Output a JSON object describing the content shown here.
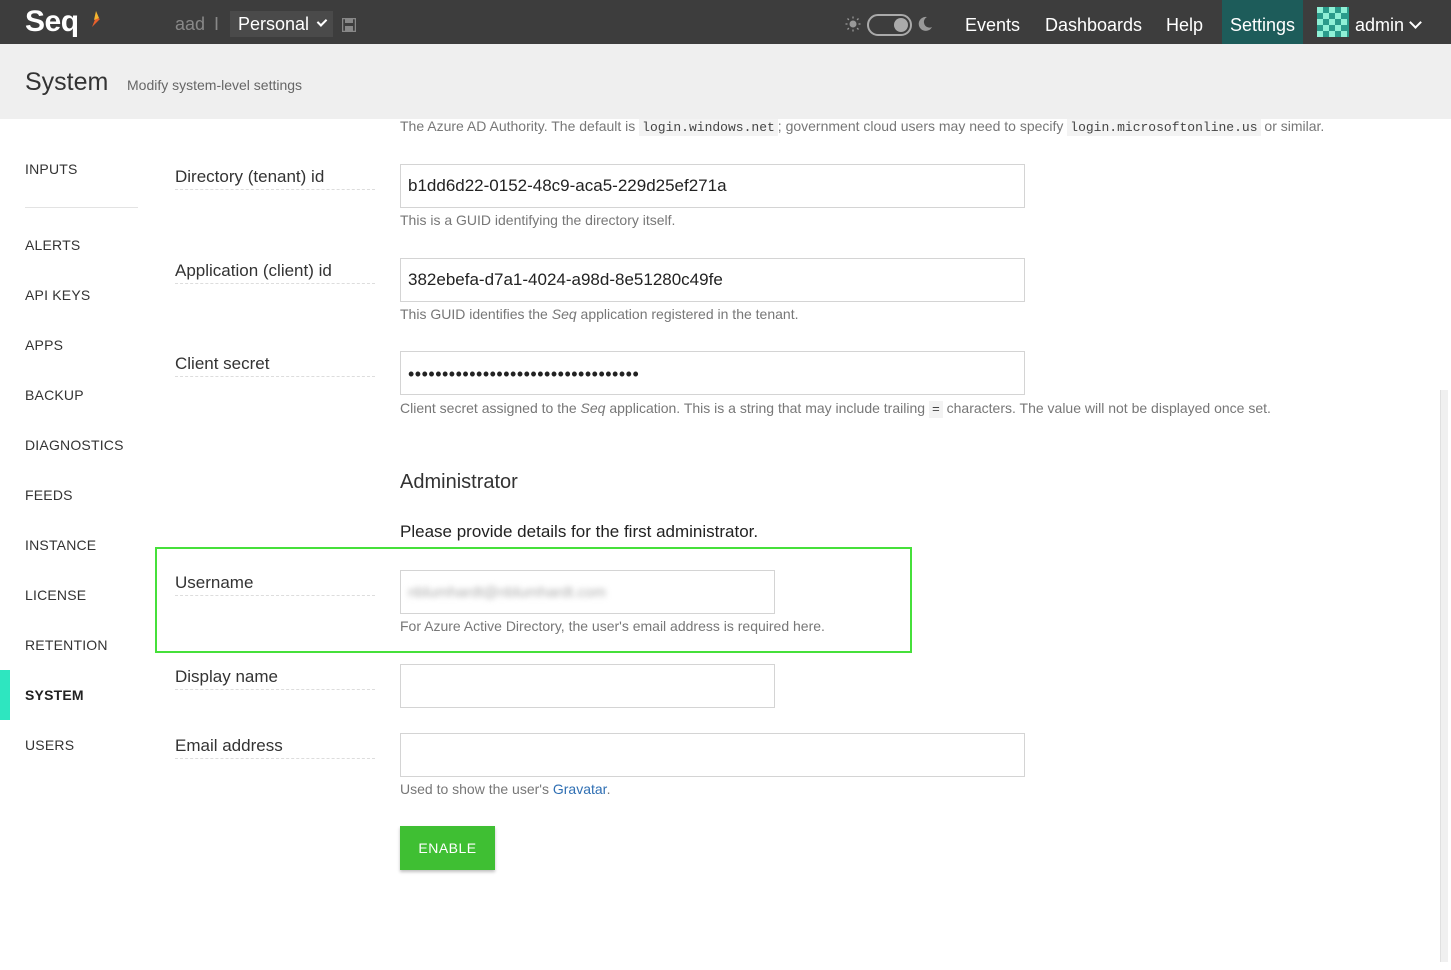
{
  "app": {
    "logo_text": "Seq",
    "workspace_label": "aad",
    "workspace_separator": "I",
    "workspace_select": "Personal",
    "nav": {
      "events": "Events",
      "dashboards": "Dashboards",
      "help": "Help",
      "settings": "Settings"
    },
    "user": "admin",
    "colors": {
      "topbar": "#3d3d3d",
      "settings_active": "#1d5c5a",
      "accent": "#2ee6c0",
      "enable_button": "#3fbf33",
      "highlight": "#46e03a"
    }
  },
  "header": {
    "title": "System",
    "subtitle": "Modify system-level settings"
  },
  "sidebar": {
    "items": [
      {
        "label": "INPUTS"
      },
      {
        "label": "ALERTS"
      },
      {
        "label": "API KEYS"
      },
      {
        "label": "APPS"
      },
      {
        "label": "BACKUP"
      },
      {
        "label": "DIAGNOSTICS"
      },
      {
        "label": "FEEDS"
      },
      {
        "label": "INSTANCE"
      },
      {
        "label": "LICENSE"
      },
      {
        "label": "RETENTION"
      },
      {
        "label": "SYSTEM"
      },
      {
        "label": "USERS"
      }
    ],
    "active": "SYSTEM"
  },
  "form": {
    "authority_help": {
      "before": "The Azure AD Authority. The default is ",
      "code1": "login.windows.net",
      "middle": "; government cloud users may need to specify ",
      "code2": "login.microsoftonline.us",
      "after": " or similar."
    },
    "tenant": {
      "label": "Directory (tenant) id",
      "value": "b1dd6d22-0152-48c9-aca5-229d25ef271a",
      "help": "This is a GUID identifying the directory itself."
    },
    "client": {
      "label": "Application (client) id",
      "value": "382ebefa-d7a1-4024-a98d-8e51280c49fe",
      "help_before": "This GUID identifies the ",
      "help_em": "Seq",
      "help_after": " application registered in the tenant."
    },
    "secret": {
      "label": "Client secret",
      "value": "••••••••••••••••••••••••••••••••••",
      "help_before": "Client secret assigned to the ",
      "help_em": "Seq",
      "help_mid": " application. This is a string that may include trailing ",
      "help_code": "=",
      "help_after": " characters. The value will not be displayed once set."
    },
    "admin_section": {
      "title": "Administrator",
      "intro": "Please provide details for the first administrator."
    },
    "username": {
      "label": "Username",
      "value": "nblumhardt@nblumhardt.com",
      "help": "For Azure Active Directory, the user's email address is required here."
    },
    "display_name": {
      "label": "Display name",
      "value": ""
    },
    "email": {
      "label": "Email address",
      "value": "",
      "help_before": "Used to show the user's ",
      "help_link": "Gravatar",
      "help_after": "."
    },
    "enable_label": "ENABLE"
  }
}
